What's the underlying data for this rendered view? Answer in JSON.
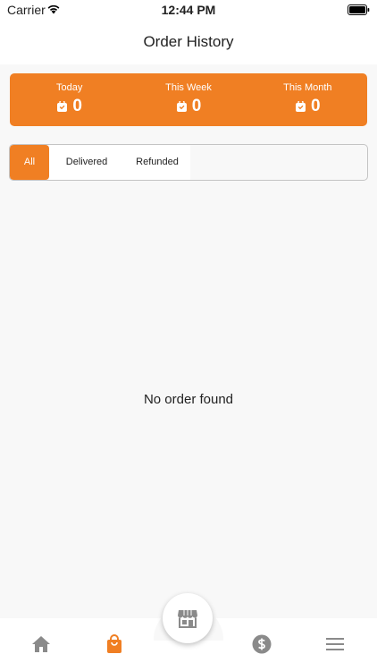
{
  "status_bar": {
    "carrier": "Carrier",
    "time": "12:44 PM"
  },
  "header": {
    "title": "Order History"
  },
  "stats": [
    {
      "label": "Today",
      "value": "0",
      "icon": "shopping-bag-icon"
    },
    {
      "label": "This Week",
      "value": "0",
      "icon": "shopping-bag-icon"
    },
    {
      "label": "This Month",
      "value": "0",
      "icon": "shopping-bag-icon"
    }
  ],
  "tabs": [
    {
      "label": "All",
      "active": true
    },
    {
      "label": "Delivered",
      "active": false
    },
    {
      "label": "Refunded",
      "active": false
    }
  ],
  "empty_state": {
    "message": "No order found"
  },
  "bottom_nav": {
    "items": [
      "home-icon",
      "orders-bag-icon",
      "store-icon",
      "dollar-icon",
      "menu-icon"
    ],
    "active": "orders-bag-icon"
  },
  "colors": {
    "accent": "#f07f23",
    "inactive_icon": "#8a8a8a",
    "background": "#f8f8f8"
  }
}
